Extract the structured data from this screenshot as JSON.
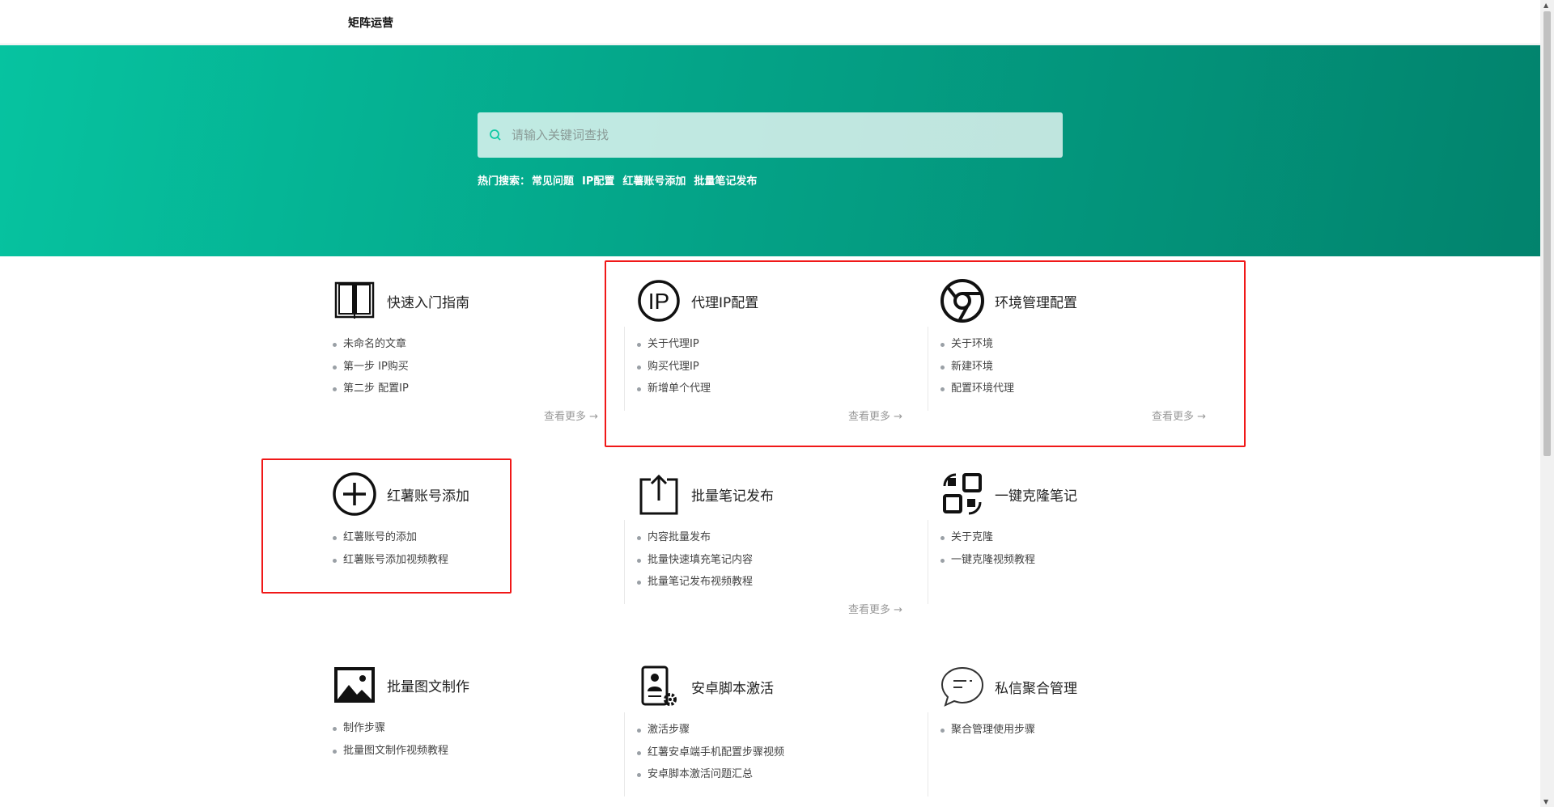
{
  "header": {
    "logo": "矩阵运营"
  },
  "search": {
    "placeholder": "请输入关键词查找",
    "hot_label": "热门搜索：",
    "hot": [
      "常见问题",
      "IP配置",
      "红薯账号添加",
      "批量笔记发布"
    ]
  },
  "more_label": "查看更多 →",
  "cards": [
    {
      "icon": "book-icon",
      "title": "快速入门指南",
      "items": [
        "未命名的文章",
        "第一步 IP购买",
        "第二步 配置IP"
      ],
      "more": true
    },
    {
      "icon": "ip-icon",
      "title": "代理IP配置",
      "items": [
        "关于代理IP",
        "购买代理IP",
        "新增单个代理"
      ],
      "more": true
    },
    {
      "icon": "chrome-icon",
      "title": "环境管理配置",
      "items": [
        "关于环境",
        "新建环境",
        "配置环境代理"
      ],
      "more": true
    },
    {
      "icon": "add-circle-icon",
      "title": "红薯账号添加",
      "items": [
        "红薯账号的添加",
        "红薯账号添加视频教程"
      ],
      "more": false
    },
    {
      "icon": "upload-icon",
      "title": "批量笔记发布",
      "items": [
        "内容批量发布",
        "批量快速填充笔记内容",
        "批量笔记发布视频教程"
      ],
      "more": true
    },
    {
      "icon": "clone-icon",
      "title": "一键克隆笔记",
      "items": [
        "关于克隆",
        "一键克隆视频教程"
      ],
      "more": false
    },
    {
      "icon": "image-icon",
      "title": "批量图文制作",
      "items": [
        "制作步骤",
        "批量图文制作视频教程"
      ],
      "more": false
    },
    {
      "icon": "android-script-icon",
      "title": "安卓脚本激活",
      "items": [
        "激活步骤",
        "红薯安卓端手机配置步骤视频",
        "安卓脚本激活问题汇总"
      ],
      "more": false
    },
    {
      "icon": "chat-icon",
      "title": "私信聚合管理",
      "items": [
        "聚合管理使用步骤"
      ],
      "more": false
    }
  ],
  "colors": {
    "accent": "#06c3a0",
    "banner_end": "#02836d",
    "highlight": "#f01818"
  }
}
